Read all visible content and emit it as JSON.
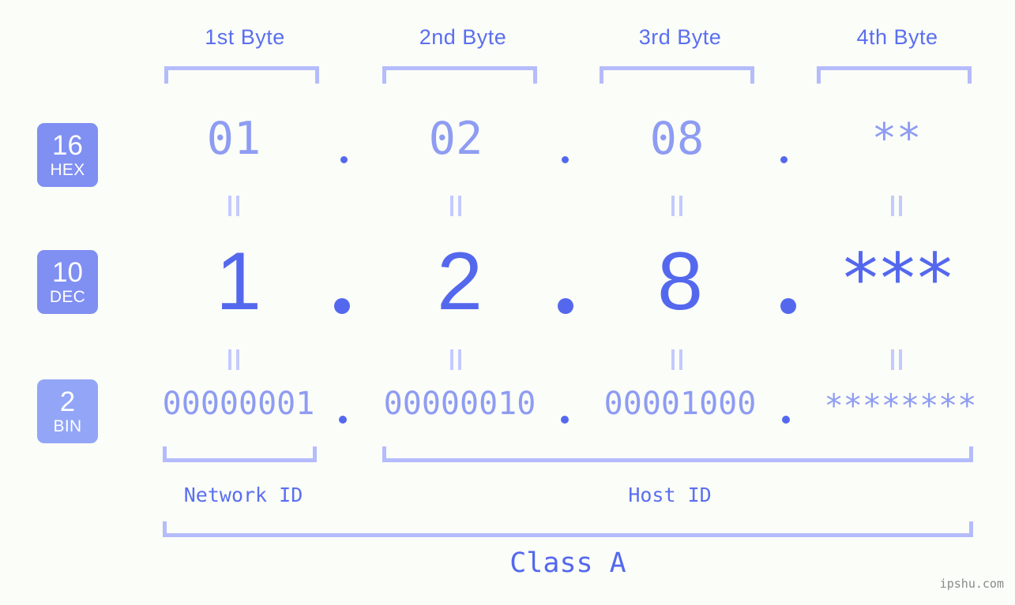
{
  "page": {
    "background_color": "#fbfdf8",
    "accent_color": "#5468ee",
    "accent_light_color": "#8e9cf2",
    "bracket_color": "#b4bcfb",
    "watermark": "ipshu.com"
  },
  "byte_headers": [
    {
      "label": "1st Byte"
    },
    {
      "label": "2nd Byte"
    },
    {
      "label": "3rd Byte"
    },
    {
      "label": "4th Byte"
    }
  ],
  "bases": [
    {
      "number": "16",
      "name": "HEX",
      "color": "#7f8ff2"
    },
    {
      "number": "10",
      "name": "DEC",
      "color": "#7f8ff2"
    },
    {
      "number": "2",
      "name": "BIN",
      "color": "#92a5f7"
    }
  ],
  "rows": {
    "hex": {
      "values": [
        "01",
        "02",
        "08",
        "**"
      ],
      "separator": "."
    },
    "dec": {
      "values": [
        "1",
        "2",
        "8",
        "***"
      ],
      "separator": "."
    },
    "bin": {
      "values": [
        "00000001",
        "00000010",
        "00001000",
        "********"
      ],
      "separator": "."
    }
  },
  "equals_marks": {
    "glyph": "ǁ",
    "count_per_row": 4,
    "rows": 2
  },
  "id_sections": [
    {
      "label": "Network ID"
    },
    {
      "label": "Host ID"
    }
  ],
  "class": {
    "label": "Class A"
  }
}
